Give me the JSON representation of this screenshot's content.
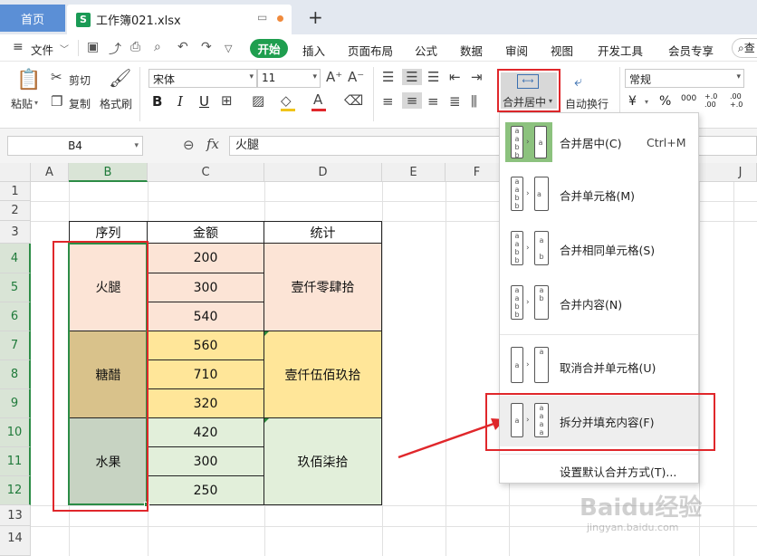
{
  "titlebar": {
    "home_tab": "首页",
    "file_tab": "工作簿021.xlsx",
    "xl_badge": "S",
    "new_tab": "+"
  },
  "menubar": {
    "file_menu": "文件",
    "tabs": [
      "开始",
      "插入",
      "页面布局",
      "公式",
      "数据",
      "审阅",
      "视图",
      "开发工具",
      "会员专享"
    ],
    "search_partial": "查"
  },
  "ribbon": {
    "paste": "粘贴",
    "cut": "剪切",
    "copy": "复制",
    "format_painter": "格式刷",
    "font_name": "宋体",
    "font_size": "11",
    "bold": "B",
    "italic": "I",
    "underline": "U",
    "merge_center": "合并居中",
    "wrap_text": "自动换行",
    "number_format": "常规",
    "currency": "¥",
    "percent": "%",
    "thousands": "000",
    "inc_decimal": "+.0 .00",
    "dec_decimal": ".00 +.0"
  },
  "formula_bar": {
    "name_box": "B4",
    "fx": "fx",
    "value": "火腿"
  },
  "grid": {
    "columns": [
      "A",
      "B",
      "C",
      "D",
      "E",
      "F",
      "J"
    ],
    "rows": [
      "1",
      "2",
      "3",
      "4",
      "5",
      "6",
      "7",
      "8",
      "9",
      "10",
      "11",
      "12",
      "13",
      "14"
    ],
    "selected_column": "B"
  },
  "table": {
    "headers": [
      "序列",
      "金额",
      "统计"
    ],
    "groups": [
      {
        "item": "火腿",
        "amounts": [
          "200",
          "300",
          "540"
        ],
        "total": "壹仟零肆拾",
        "color_item": "#fce4d6",
        "color_amount": "#fce4d6"
      },
      {
        "item": "糖醋",
        "amounts": [
          "560",
          "710",
          "320"
        ],
        "total": "壹仟伍佰玖拾",
        "color_item": "#d9c28b",
        "color_amount": "#ffe699"
      },
      {
        "item": "水果",
        "amounts": [
          "420",
          "300",
          "250"
        ],
        "total": "玖佰柒拾",
        "color_item": "#c7d3c2",
        "color_amount": "#e2efda"
      }
    ]
  },
  "merge_menu": {
    "items": [
      {
        "label": "合并居中(C)",
        "shortcut": "Ctrl+M"
      },
      {
        "label": "合并单元格(M)",
        "shortcut": ""
      },
      {
        "label": "合并相同单元格(S)",
        "shortcut": ""
      },
      {
        "label": "合并内容(N)",
        "shortcut": ""
      },
      {
        "label": "取消合并单元格(U)",
        "shortcut": ""
      },
      {
        "label": "拆分并填充内容(F)",
        "shortcut": ""
      }
    ],
    "footer": "设置默认合并方式(T)...",
    "icon_letters": [
      "a",
      "b"
    ]
  },
  "watermark": {
    "brand": "Baidu经验",
    "url": "jingyan.baidu.com"
  },
  "colors": {
    "accent_green": "#1f9e4f",
    "highlight_red": "#e0272b",
    "home_tab_blue": "#5b8fd6"
  }
}
